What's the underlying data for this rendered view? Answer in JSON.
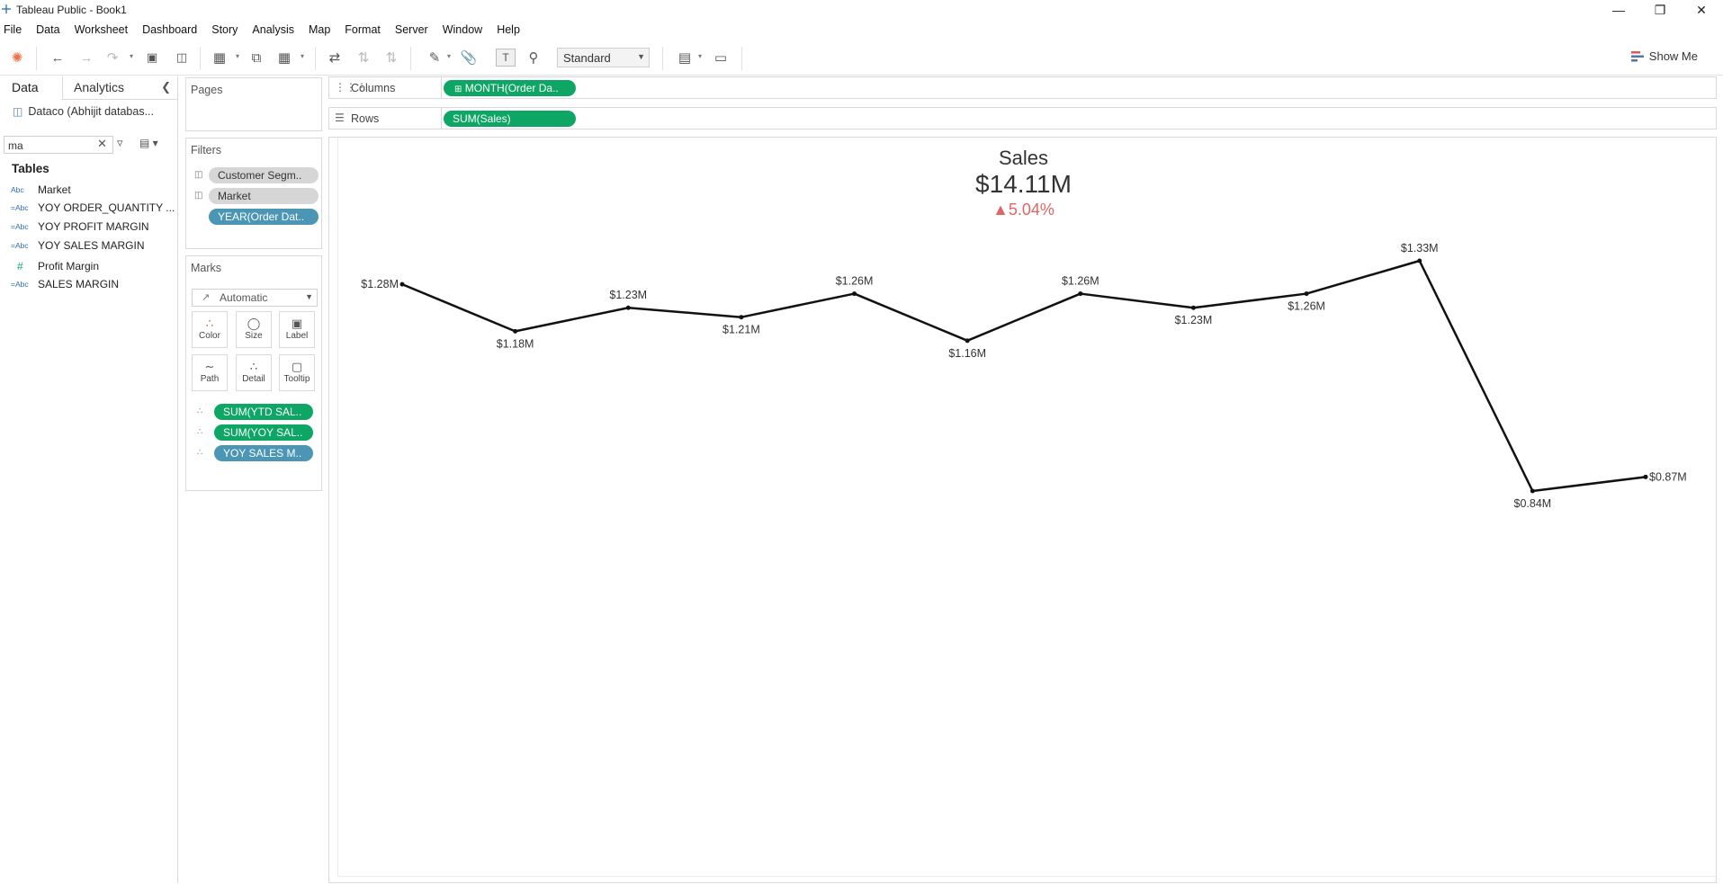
{
  "window": {
    "title": "Tableau Public - Book1"
  },
  "menu": [
    "File",
    "Data",
    "Worksheet",
    "Dashboard",
    "Story",
    "Analysis",
    "Map",
    "Format",
    "Server",
    "Window",
    "Help"
  ],
  "toolbar": {
    "fit": "Standard",
    "show_me": "Show Me"
  },
  "data_pane": {
    "tab_data": "Data",
    "tab_analytics": "Analytics",
    "datasource": "Dataco (Abhijit databas...",
    "search_value": "ma",
    "tables_header": "Tables",
    "fields": [
      {
        "type": "Abc",
        "name": "Market"
      },
      {
        "type": "=Abc",
        "name": "YOY ORDER_QUANTITY ..."
      },
      {
        "type": "=Abc",
        "name": "YOY PROFIT MARGIN"
      },
      {
        "type": "=Abc",
        "name": "YOY SALES MARGIN"
      },
      {
        "type": "#",
        "name": "Profit Margin"
      },
      {
        "type": "=Abc",
        "name": "SALES MARGIN"
      }
    ]
  },
  "pages": {
    "title": "Pages"
  },
  "filters": {
    "title": "Filters",
    "items": [
      "Customer Segm..",
      "Market",
      "YEAR(Order Dat.."
    ]
  },
  "marks": {
    "title": "Marks",
    "type": "Automatic",
    "buttons": [
      "Color",
      "Size",
      "Label",
      "Path",
      "Detail",
      "Tooltip"
    ],
    "pills": [
      "SUM(YTD SAL..",
      "SUM(YOY SAL..",
      "YOY SALES M.."
    ]
  },
  "shelves": {
    "columns_label": "Columns",
    "columns_pill": "MONTH(Order Da..",
    "rows_label": "Rows",
    "rows_pill": "SUM(Sales)"
  },
  "kpi": {
    "title": "Sales",
    "value": "$14.11M",
    "delta": "▲5.04%",
    "delta_color": "#e06666"
  },
  "chart_data": {
    "type": "line",
    "x": [
      1,
      2,
      3,
      4,
      5,
      6,
      7,
      8,
      9,
      10,
      11,
      12
    ],
    "series": [
      {
        "values": [
          1.28,
          1.18,
          1.23,
          1.21,
          1.26,
          1.16,
          1.26,
          1.23,
          1.26,
          1.33,
          0.84,
          0.87
        ]
      }
    ],
    "labels": [
      "$1.28M",
      "$1.18M",
      "$1.23M",
      "$1.21M",
      "$1.26M",
      "$1.16M",
      "$1.26M",
      "$1.23M",
      "$1.26M",
      "$1.33M",
      "$0.84M",
      "$0.87M"
    ],
    "label_positions": [
      "left",
      "below",
      "above",
      "below",
      "above",
      "below",
      "above",
      "below",
      "below",
      "above",
      "below",
      "right"
    ],
    "ylim": [
      0.84,
      1.33
    ],
    "line_color": "#111111",
    "grid": false
  }
}
